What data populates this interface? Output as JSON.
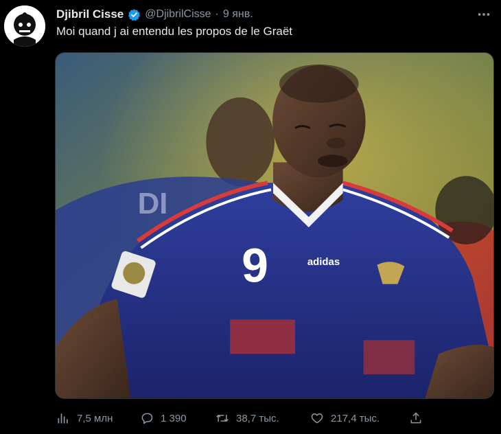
{
  "tweet": {
    "author_name": "Djibril Cisse",
    "handle": "@DjibrilCisse",
    "separator": "·",
    "date": "9 янв.",
    "text": "Moi quand j ai entendu les propos de le Graët",
    "more_icon": "more-dots-icon",
    "verified_icon": "verified-badge-icon"
  },
  "actions": {
    "views": {
      "icon": "bar-chart-icon",
      "count": "7,5 млн"
    },
    "reply": {
      "icon": "reply-icon",
      "count": "1 390"
    },
    "retweet": {
      "icon": "retweet-icon",
      "count": "38,7 тыс."
    },
    "like": {
      "icon": "heart-icon",
      "count": "217,4 тыс."
    },
    "share": {
      "icon": "share-icon"
    }
  },
  "colors": {
    "background": "#000000",
    "text": "#e7e9ea",
    "muted": "#8b98a5",
    "verified": "#1d9bf0"
  }
}
